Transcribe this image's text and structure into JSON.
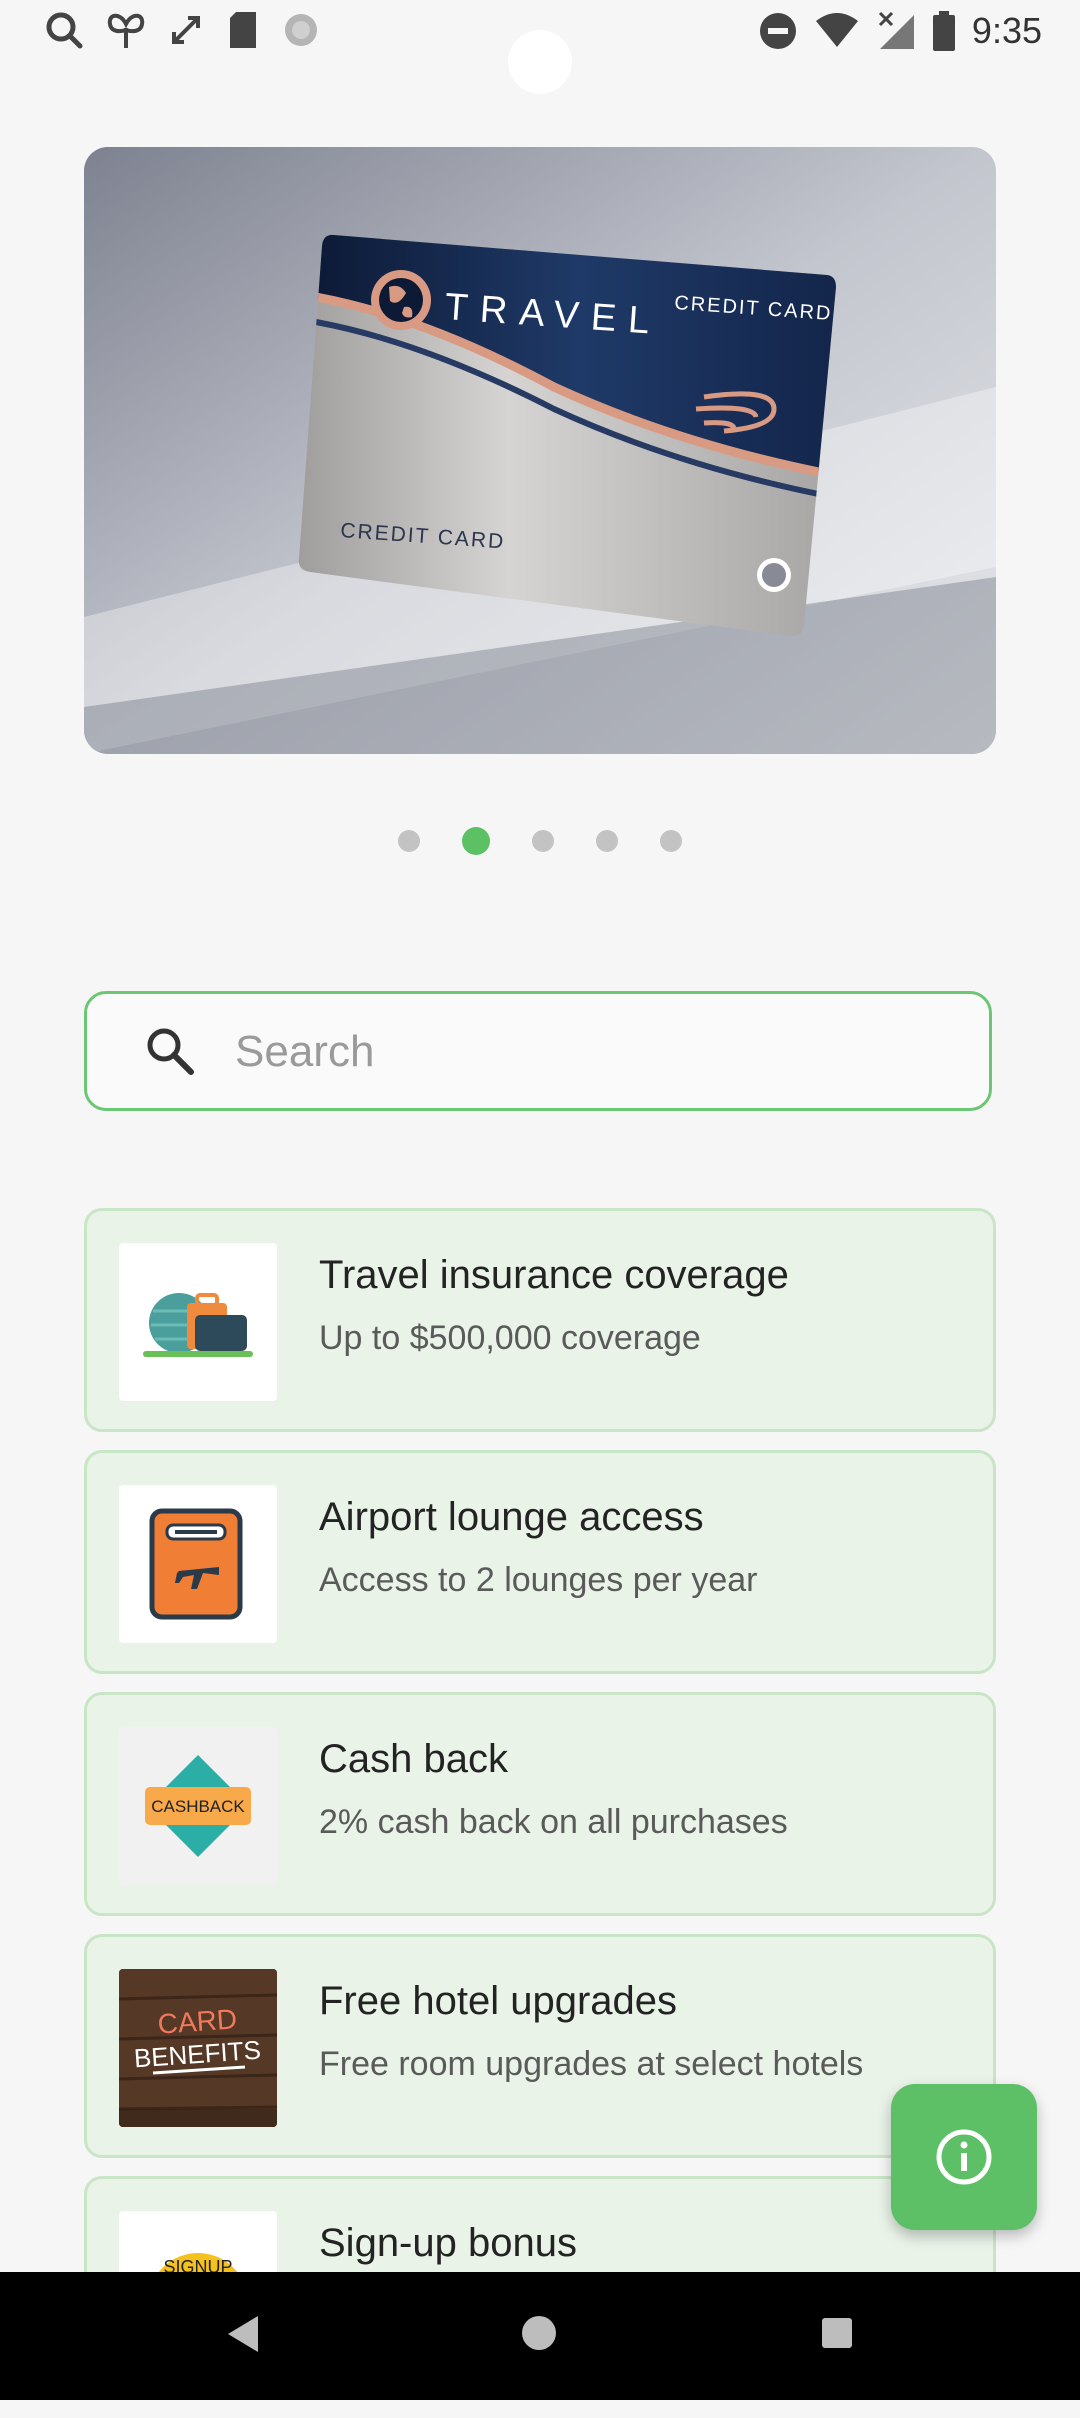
{
  "status_bar": {
    "time": "9:35",
    "left_icons": [
      "search-icon",
      "butterfly-icon",
      "screen-rotate-icon",
      "sd-card-icon",
      "loading-icon"
    ],
    "right_icons": [
      "do-not-disturb-icon",
      "wifi-icon",
      "signal-no-data-icon",
      "battery-icon"
    ]
  },
  "hero": {
    "card_brand": "TRAVEL",
    "card_label_top": "CREDIT CARD",
    "card_label_bottom": "CREDIT CARD"
  },
  "carousel": {
    "count": 5,
    "active_index": 1
  },
  "search": {
    "placeholder": "Search",
    "value": ""
  },
  "benefits": [
    {
      "title": "Travel insurance coverage",
      "subtitle": "Up to $500,000 coverage",
      "icon": "luggage-globe-icon"
    },
    {
      "title": "Airport lounge access",
      "subtitle": "Access to 2 lounges per year",
      "icon": "boarding-pass-icon"
    },
    {
      "title": "Cash back",
      "subtitle": "2% cash back on all purchases",
      "icon": "cashback-icon",
      "badge": "CASHBACK"
    },
    {
      "title": "Free hotel upgrades",
      "subtitle": "Free room upgrades at select hotels",
      "icon": "card-benefits-image",
      "badge_line1": "CARD",
      "badge_line2": "BENEFITS"
    },
    {
      "title": "Sign-up bonus",
      "subtitle": "",
      "icon": "signup-badge-icon",
      "badge": "SIGNUP"
    }
  ],
  "fab": {
    "icon": "info-icon"
  },
  "colors": {
    "accent": "#5dbf66",
    "card_bg": "#e9f3e8",
    "card_border": "#c8e6c5"
  }
}
